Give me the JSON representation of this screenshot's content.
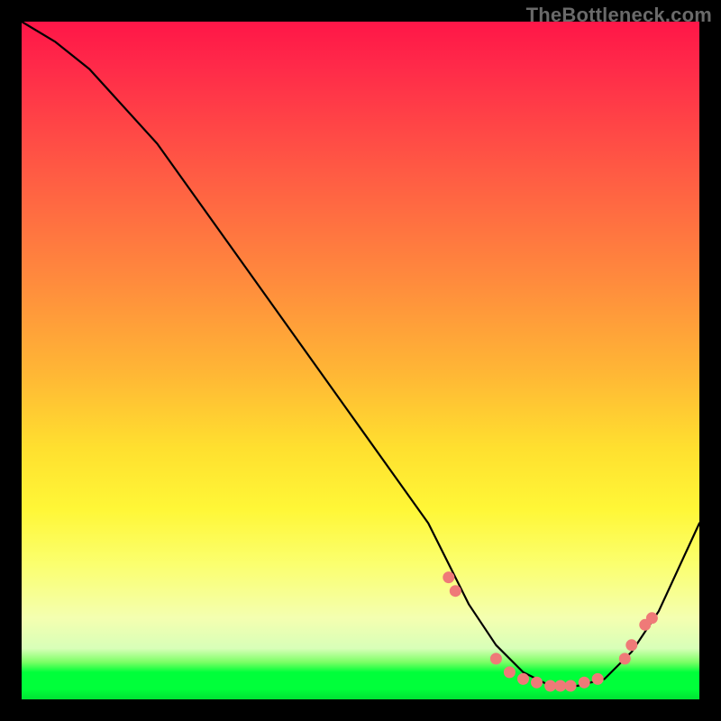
{
  "watermark": "TheBottleneck.com",
  "chart_data": {
    "type": "line",
    "title": "",
    "xlabel": "",
    "ylabel": "",
    "xlim": [
      0,
      100
    ],
    "ylim": [
      0,
      100
    ],
    "background_gradient": {
      "direction": "vertical",
      "stops": [
        {
          "pos": 0,
          "color": "#ff1648"
        },
        {
          "pos": 0.22,
          "color": "#ff5a44"
        },
        {
          "pos": 0.52,
          "color": "#ffb735"
        },
        {
          "pos": 0.72,
          "color": "#fff737"
        },
        {
          "pos": 0.88,
          "color": "#f4ffb0"
        },
        {
          "pos": 0.96,
          "color": "#00ff3a"
        },
        {
          "pos": 1.0,
          "color": "#00e234"
        }
      ]
    },
    "series": [
      {
        "name": "bottleneck-curve",
        "x": [
          0,
          5,
          10,
          20,
          30,
          40,
          50,
          60,
          66,
          70,
          74,
          78,
          82,
          86,
          90,
          94,
          100
        ],
        "y": [
          100,
          97,
          93,
          82,
          68,
          54,
          40,
          26,
          14,
          8,
          4,
          2,
          2,
          3,
          7,
          13,
          26
        ]
      }
    ],
    "markers": {
      "name": "highlighted-points",
      "color": "#ef7a78",
      "points": [
        {
          "x": 63,
          "y": 18
        },
        {
          "x": 64,
          "y": 16
        },
        {
          "x": 70,
          "y": 6
        },
        {
          "x": 72,
          "y": 4
        },
        {
          "x": 74,
          "y": 3
        },
        {
          "x": 76,
          "y": 2.5
        },
        {
          "x": 78,
          "y": 2
        },
        {
          "x": 79.5,
          "y": 2
        },
        {
          "x": 81,
          "y": 2
        },
        {
          "x": 83,
          "y": 2.5
        },
        {
          "x": 85,
          "y": 3
        },
        {
          "x": 89,
          "y": 6
        },
        {
          "x": 90,
          "y": 8
        },
        {
          "x": 92,
          "y": 11
        },
        {
          "x": 93,
          "y": 12
        }
      ]
    }
  }
}
